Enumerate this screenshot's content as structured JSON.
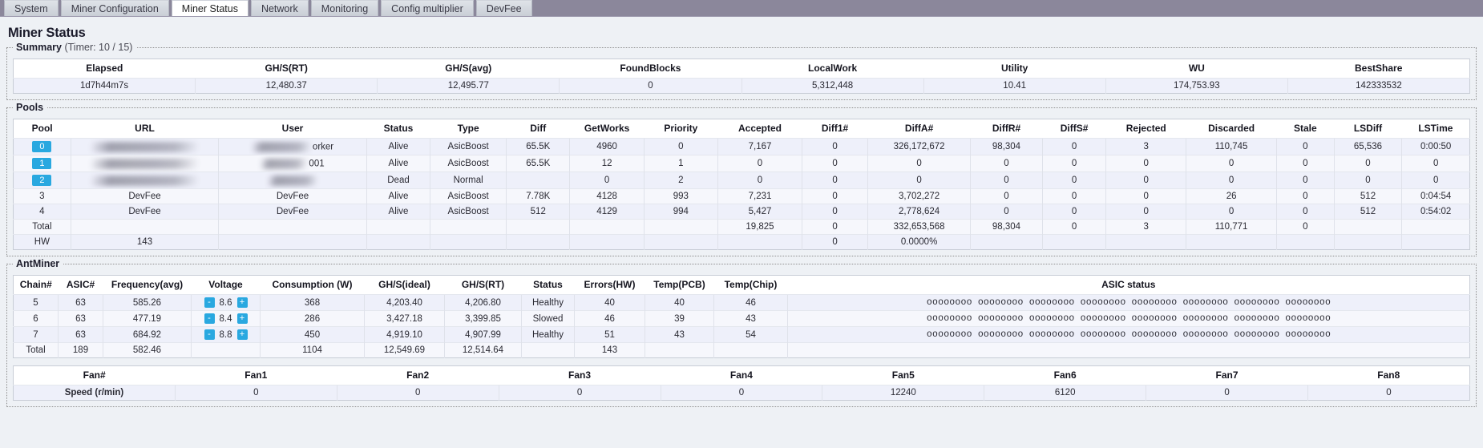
{
  "tabs": [
    {
      "label": "System",
      "active": false
    },
    {
      "label": "Miner Configuration",
      "active": false
    },
    {
      "label": "Miner Status",
      "active": true
    },
    {
      "label": "Network",
      "active": false
    },
    {
      "label": "Monitoring",
      "active": false
    },
    {
      "label": "Config multiplier",
      "active": false
    },
    {
      "label": "DevFee",
      "active": false
    }
  ],
  "page": {
    "title": "Miner Status"
  },
  "summary": {
    "legend": "Summary",
    "timer": "(Timer: 10 / 15)",
    "columns": [
      "Elapsed",
      "GH/S(RT)",
      "GH/S(avg)",
      "FoundBlocks",
      "LocalWork",
      "Utility",
      "WU",
      "BestShare"
    ],
    "row": [
      "1d7h44m7s",
      "12,480.37",
      "12,495.77",
      "0",
      "5,312,448",
      "10.41",
      "174,753.93",
      "142333532"
    ]
  },
  "pools": {
    "legend": "Pools",
    "columns": [
      "Pool",
      "URL",
      "User",
      "Status",
      "Type",
      "Diff",
      "GetWorks",
      "Priority",
      "Accepted",
      "Diff1#",
      "DiffA#",
      "DiffR#",
      "DiffS#",
      "Rejected",
      "Discarded",
      "Stale",
      "LSDiff",
      "LSTime"
    ],
    "rows": [
      {
        "pool": "0",
        "badge": true,
        "url": "",
        "url_redacted": true,
        "user": "orker",
        "user_redacted": true,
        "status": "Alive",
        "type": "AsicBoost",
        "diff": "65.5K",
        "getworks": "4960",
        "priority": "0",
        "accepted": "7,167",
        "diff1": "0",
        "diffa": "326,172,672",
        "diffr": "98,304",
        "diffs": "0",
        "rejected": "3",
        "discarded": "110,745",
        "stale": "0",
        "lsdiff": "65,536",
        "lstime": "0:00:50"
      },
      {
        "pool": "1",
        "badge": true,
        "url": "",
        "url_redacted": true,
        "user": "001",
        "user_redacted": true,
        "status": "Alive",
        "type": "AsicBoost",
        "diff": "65.5K",
        "getworks": "12",
        "priority": "1",
        "accepted": "0",
        "diff1": "0",
        "diffa": "0",
        "diffr": "0",
        "diffs": "0",
        "rejected": "0",
        "discarded": "0",
        "stale": "0",
        "lsdiff": "0",
        "lstime": "0"
      },
      {
        "pool": "2",
        "badge": true,
        "url": "",
        "url_redacted": true,
        "user": "",
        "user_redacted": true,
        "status": "Dead",
        "type": "Normal",
        "diff": "",
        "getworks": "0",
        "priority": "2",
        "accepted": "0",
        "diff1": "0",
        "diffa": "0",
        "diffr": "0",
        "diffs": "0",
        "rejected": "0",
        "discarded": "0",
        "stale": "0",
        "lsdiff": "0",
        "lstime": "0"
      },
      {
        "pool": "3",
        "badge": false,
        "url": "DevFee",
        "url_redacted": false,
        "user": "DevFee",
        "user_redacted": false,
        "status": "Alive",
        "type": "AsicBoost",
        "diff": "7.78K",
        "getworks": "4128",
        "priority": "993",
        "accepted": "7,231",
        "diff1": "0",
        "diffa": "3,702,272",
        "diffr": "0",
        "diffs": "0",
        "rejected": "0",
        "discarded": "26",
        "stale": "0",
        "lsdiff": "512",
        "lstime": "0:04:54"
      },
      {
        "pool": "4",
        "badge": false,
        "url": "DevFee",
        "url_redacted": false,
        "user": "DevFee",
        "user_redacted": false,
        "status": "Alive",
        "type": "AsicBoost",
        "diff": "512",
        "getworks": "4129",
        "priority": "994",
        "accepted": "5,427",
        "diff1": "0",
        "diffa": "2,778,624",
        "diffr": "0",
        "diffs": "0",
        "rejected": "0",
        "discarded": "0",
        "stale": "0",
        "lsdiff": "512",
        "lstime": "0:54:02"
      }
    ],
    "total_row": {
      "pool": "Total",
      "url": "",
      "user": "",
      "status": "",
      "type": "",
      "diff": "",
      "getworks": "",
      "priority": "",
      "accepted": "19,825",
      "diff1": "0",
      "diffa": "332,653,568",
      "diffr": "98,304",
      "diffs": "0",
      "rejected": "3",
      "discarded": "110,771",
      "stale": "0",
      "lsdiff": "",
      "lstime": ""
    },
    "hw_row": {
      "pool": "HW",
      "url": "143",
      "user": "",
      "status": "",
      "type": "",
      "diff": "",
      "getworks": "",
      "priority": "",
      "accepted": "",
      "diff1": "0",
      "diffa": "0.0000%",
      "diffr": "",
      "diffs": "",
      "rejected": "",
      "discarded": "",
      "stale": "",
      "lsdiff": "",
      "lstime": ""
    }
  },
  "antminer": {
    "legend": "AntMiner",
    "columns": [
      "Chain#",
      "ASIC#",
      "Frequency(avg)",
      "Voltage",
      "Consumption (W)",
      "GH/S(ideal)",
      "GH/S(RT)",
      "Status",
      "Errors(HW)",
      "Temp(PCB)",
      "Temp(Chip)",
      "ASIC status"
    ],
    "rows": [
      {
        "chain": "5",
        "asic": "63",
        "freq": "585.26",
        "voltage": "8.6",
        "minus": "-",
        "plus": "+",
        "consumption": "368",
        "ideal": "4,203.40",
        "rt": "4,206.80",
        "status": "Healthy",
        "errors": "40",
        "temp_pcb": "40",
        "temp_chip": "46",
        "asic_status": "oooooooo oooooooo oooooooo oooooooo oooooooo oooooooo oooooooo oooooooo"
      },
      {
        "chain": "6",
        "asic": "63",
        "freq": "477.19",
        "voltage": "8.4",
        "minus": "-",
        "plus": "+",
        "consumption": "286",
        "ideal": "3,427.18",
        "rt": "3,399.85",
        "status": "Slowed",
        "errors": "46",
        "temp_pcb": "39",
        "temp_chip": "43",
        "asic_status": "oooooooo oooooooo oooooooo oooooooo oooooooo oooooooo oooooooo oooooooo"
      },
      {
        "chain": "7",
        "asic": "63",
        "freq": "684.92",
        "voltage": "8.8",
        "minus": "-",
        "plus": "+",
        "consumption": "450",
        "ideal": "4,919.10",
        "rt": "4,907.99",
        "status": "Healthy",
        "errors": "51",
        "temp_pcb": "43",
        "temp_chip": "54",
        "asic_status": "oooooooo oooooooo oooooooo oooooooo oooooooo oooooooo oooooooo oooooooo"
      }
    ],
    "total_row": {
      "chain": "Total",
      "asic": "189",
      "freq": "582.46",
      "voltage": "",
      "consumption": "1104",
      "ideal": "12,549.69",
      "rt": "12,514.64",
      "status": "",
      "errors": "143",
      "temp_pcb": "",
      "temp_chip": "",
      "asic_status": ""
    }
  },
  "fans": {
    "columns": [
      "Fan#",
      "Fan1",
      "Fan2",
      "Fan3",
      "Fan4",
      "Fan5",
      "Fan6",
      "Fan7",
      "Fan8"
    ],
    "row_label": "Speed (r/min)",
    "values": [
      "0",
      "0",
      "0",
      "0",
      "12240",
      "6120",
      "0",
      "0"
    ]
  },
  "colors": {
    "accent": "#29a8e0",
    "tabbar_bg": "#8b879b",
    "row_bg": "#eef0fa",
    "page_bg": "#eef1f5"
  }
}
